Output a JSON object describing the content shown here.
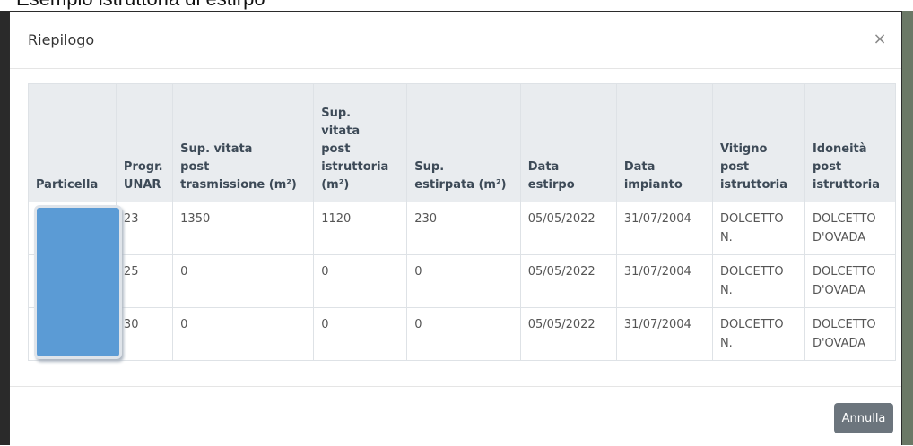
{
  "page_caption": "Esempio istruttoria di estirpo",
  "modal": {
    "title": "Riepilogo",
    "close_symbol": "×",
    "footer": {
      "annulla_label": "Annulla"
    }
  },
  "table": {
    "headers": [
      [
        "Particella"
      ],
      [
        "Progr.",
        "UNAR"
      ],
      [
        "Sup. vitata",
        "post",
        "trasmissione (m²)"
      ],
      [
        "Sup.",
        "vitata",
        "post",
        "istruttoria",
        "(m²)"
      ],
      [
        "Sup.",
        "estirpata (m²)"
      ],
      [
        "Data",
        "estirpo"
      ],
      [
        "Data",
        "impianto"
      ],
      [
        "Vitigno",
        "post",
        "istruttoria"
      ],
      [
        "Idoneità",
        "post",
        "istruttoria"
      ]
    ],
    "rows": [
      {
        "particella": "",
        "progr_unar": "23",
        "sup_trasmissione": "1350",
        "sup_istruttoria": "1120",
        "sup_estirpata": "230",
        "data_estirpo": "05/05/2022",
        "data_impianto": "31/07/2004",
        "vitigno": [
          "DOLCETTO",
          "N."
        ],
        "idoneita": [
          "DOLCETTO",
          "D'OVADA"
        ]
      },
      {
        "particella": "",
        "progr_unar": "25",
        "sup_trasmissione": "0",
        "sup_istruttoria": "0",
        "sup_estirpata": "0",
        "data_estirpo": "05/05/2022",
        "data_impianto": "31/07/2004",
        "vitigno": [
          "DOLCETTO",
          "N."
        ],
        "idoneita": [
          "DOLCETTO",
          "D'OVADA"
        ]
      },
      {
        "particella": "",
        "progr_unar": "30",
        "sup_trasmissione": "0",
        "sup_istruttoria": "0",
        "sup_estirpata": "0",
        "data_estirpo": "05/05/2022",
        "data_impianto": "31/07/2004",
        "vitigno": [
          "DOLCETTO",
          "N."
        ],
        "idoneita": [
          "DOLCETTO",
          "D'OVADA"
        ]
      }
    ]
  },
  "colors": {
    "header_bg": "#e9ecef",
    "button_bg": "#6c757d",
    "redaction": "#5b9bd5"
  }
}
